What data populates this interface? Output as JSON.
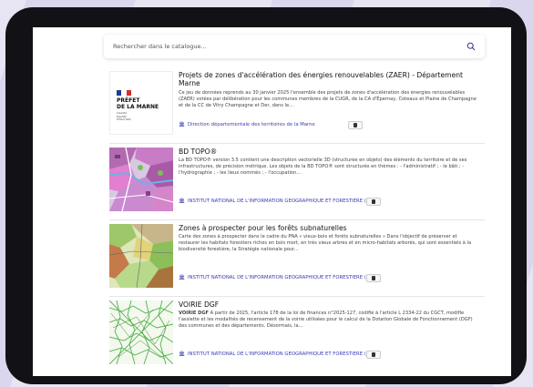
{
  "search": {
    "placeholder": "Rechercher dans le catalogue..."
  },
  "results": [
    {
      "thumb_lines": [
        "PRÉFET",
        "DE LA MARNE"
      ],
      "thumb_motto": [
        "Liberté",
        "Égalité",
        "Fraternité"
      ],
      "title": "Projets de zones d'accélération des énergies renouvelables (ZAER) - Département Marne",
      "description": "Ce jeu de données reprends au 30 janvier 2025 l'ensemble des projets de zones d'accélération des énergies renouvelables (ZAER) votées par délibération pour les communes membres de la CUGR, de la CA d'Épernay, Coteaux et Plaine de Champagne et de la CC de Vitry Champagne et Der, dans le...",
      "organization": "Direction départementale des territoires de la Marne"
    },
    {
      "title": "BD TOPO®",
      "description": "La BD TOPO® version 3.5 contient une description vectorielle 3D (structurée en objets) des éléments du territoire et de ses infrastructures, de précision métrique. Les objets de la BD TOPO® sont structurés en thèmes : - l'administratif ; - le bâti ; - l'hydrographie ; - les lieux nommés ; - l'occupation...",
      "organization": "INSTITUT NATIONAL DE L'INFORMATION GEOGRAPHIQUE ET FORESTIERE (IGN)"
    },
    {
      "title": "Zones à prospecter pour les forêts subnaturelles",
      "description": "Carte des zones à prospecter dans le cadre du PNA « vieux-bois et forêts subnaturelles » Dans l'objectif de préserver et restaurer les habitats forestiers riches en bois mort, en très vieux arbres et en micro-habitats arborés, qui sont essentiels à la biodiversité forestière, la Stratégie nationale pour...",
      "organization": "INSTITUT NATIONAL DE L'INFORMATION GEOGRAPHIQUE ET FORESTIERE (IGN)"
    },
    {
      "title": "VOIRIE DGF",
      "description_bold": "VOIRIE DGF",
      "description": " A partir de 2025, l'article 178 de la loi de finances n°2025-127, codifié à l'article L 2334-22 du CGCT, modifie l'assiette et les modalités de recensement de la voirie utilisées pour le calcul de la Dotation Globale de Fonctionnement (DGF) des communes et des départements. Désormais, la...",
      "organization": "INSTITUT NATIONAL DE L'INFORMATION GEOGRAPHIQUE ET FORESTIERE (IGN)"
    }
  ]
}
